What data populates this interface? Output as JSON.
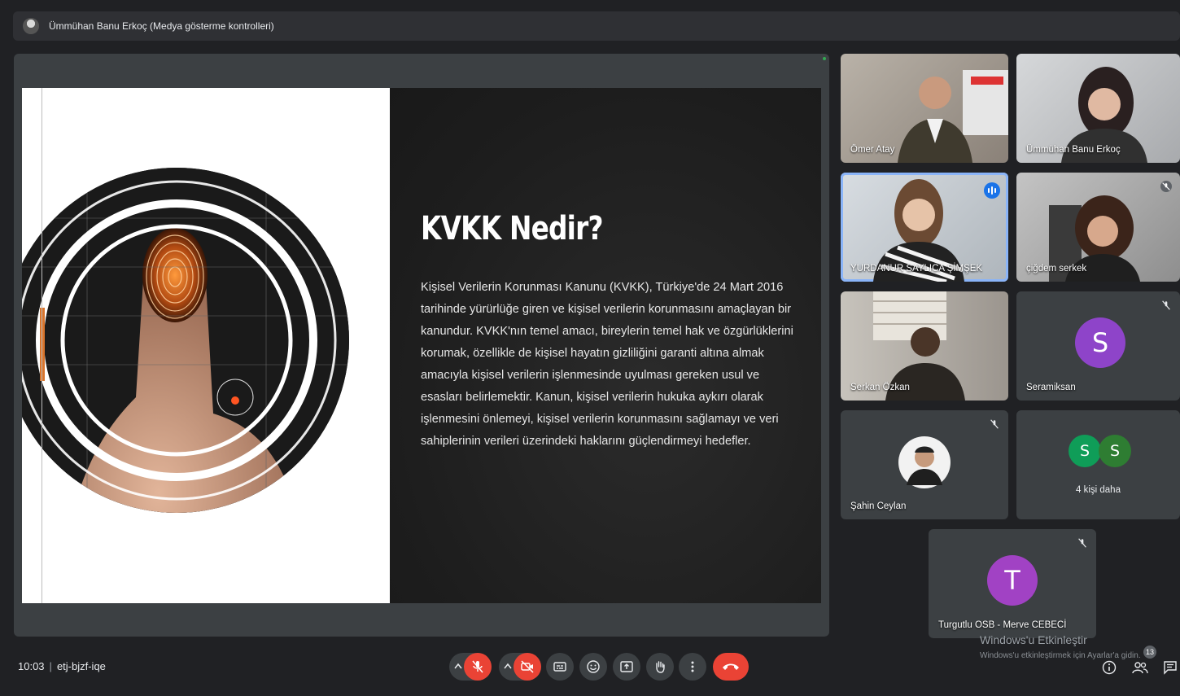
{
  "header": {
    "presenter_label": "Ümmühan Banu Erkoç (Medya gösterme kontrolleri)"
  },
  "slide": {
    "title": "KVKK Nedir?",
    "body": "Kişisel Verilerin Korunması Kanunu (KVKK), Türkiye'de 24 Mart 2016 tarihinde yürürlüğe giren ve kişisel verilerin korunmasını amaçlayan bir kanundur. KVKK'nın temel amacı, bireylerin temel hak ve özgürlüklerini korumak, özellikle de kişisel hayatın gizliliğini garanti altına almak amacıyla kişisel verilerin işlenmesinde uyulması gereken usul ve esasları belirlemektir. Kanun, kişisel verilerin hukuka aykırı olarak işlenmesini önlemeyi, kişisel verilerin korunmasını sağlamayı ve veri sahiplerinin verileri üzerindeki haklarını güçlendirmeyi hedefler."
  },
  "participants": [
    {
      "name": "Ömer Atay"
    },
    {
      "name": "Ümmühan Banu Erkoç"
    },
    {
      "name": "YURDANUR SAYLICA ŞİMŞEK"
    },
    {
      "name": "çiğdem serkek"
    },
    {
      "name": "Serkan Özkan"
    },
    {
      "name": "Seramiksan",
      "initial": "S",
      "color": "#8e44c9"
    },
    {
      "name": "Şahin Ceylan"
    },
    {
      "name": "4 kişi daha",
      "initials": [
        "S",
        "S"
      ],
      "colors": [
        "#0f9d58",
        "#2e7d32"
      ]
    },
    {
      "name": "Turgutlu OSB - Merve CEBECİ",
      "initial": "T",
      "color": "#a142c4"
    }
  ],
  "meeting": {
    "time": "10:03",
    "code": "etj-bjzf-iqe"
  },
  "people_count": "13",
  "watermark": {
    "title": "Windows'u Etkinleştir",
    "subtitle": "Windows'u etkinleştirmek için Ayarlar'a gidin."
  }
}
